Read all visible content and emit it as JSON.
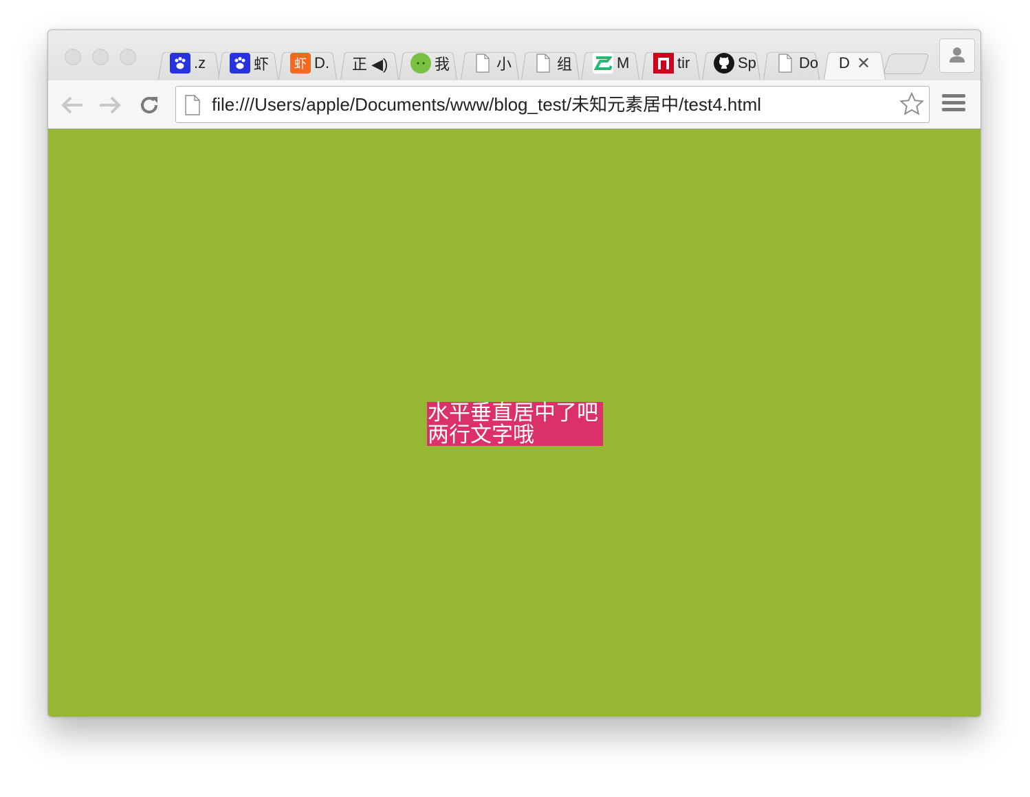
{
  "browser": {
    "tabs": [
      {
        "label": ".z",
        "icon": "baidu-paw-icon"
      },
      {
        "label": "虾",
        "icon": "baidu-paw-icon"
      },
      {
        "label": "D.",
        "icon": "xiami-icon",
        "icon_text": "虾"
      },
      {
        "label": "正 ◀)",
        "icon": "none"
      },
      {
        "label": "我",
        "icon": "wechat-icon"
      },
      {
        "label": "小",
        "icon": "page-icon"
      },
      {
        "label": "组",
        "icon": "page-icon"
      },
      {
        "label": "M",
        "icon": "green-z-icon"
      },
      {
        "label": "tir",
        "icon": "red-n-icon"
      },
      {
        "label": "Sp",
        "icon": "github-icon"
      },
      {
        "label": "Do",
        "icon": "page-icon"
      },
      {
        "label": "D",
        "icon": "none",
        "active": true,
        "close": "✕"
      }
    ],
    "address": "file:///Users/apple/Documents/www/blog_test/未知元素居中/test4.html"
  },
  "page": {
    "background_color": "#95b733",
    "box_color": "#dc3168",
    "box_lines": [
      "水平垂直居中了吧",
      "两行文字哦"
    ]
  }
}
